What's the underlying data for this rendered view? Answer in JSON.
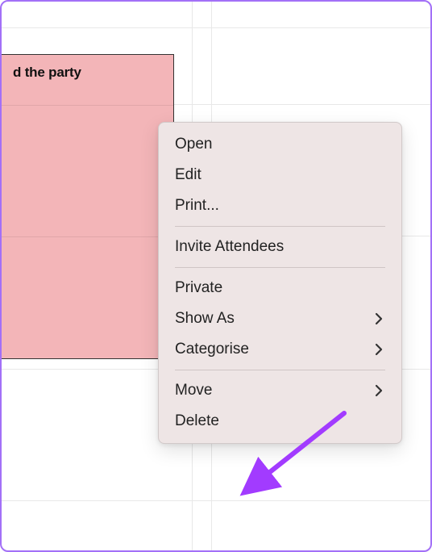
{
  "event": {
    "title": "d the party"
  },
  "menu": {
    "open": "Open",
    "edit": "Edit",
    "print": "Print...",
    "invite": "Invite Attendees",
    "private": "Private",
    "show_as": "Show As",
    "categorise": "Categorise",
    "move": "Move",
    "delete": "Delete"
  },
  "colors": {
    "event_bg": "#f3b5b8",
    "menu_bg": "#eee5e5",
    "arrow": "#a23bff"
  }
}
